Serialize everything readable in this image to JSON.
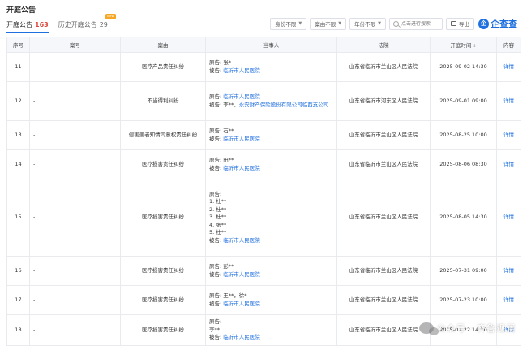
{
  "page": {
    "title": "开庭公告"
  },
  "tabs": [
    {
      "label": "开庭公告",
      "count": "163",
      "active": true
    },
    {
      "label": "历史开庭公告",
      "count": "29",
      "badge": "new"
    }
  ],
  "filters": {
    "identity": "身份不限",
    "cause": "案由不限",
    "year": "年份不限",
    "search_placeholder": "点击进行搜索",
    "export": "导出"
  },
  "brand": {
    "logo": "企",
    "name": "企查查"
  },
  "table": {
    "headers": [
      "序号",
      "案号",
      "案由",
      "当事人",
      "法院",
      "开庭时间",
      "内容"
    ],
    "rows": [
      {
        "no": "11",
        "case": "-",
        "cause": "医疗产品责任纠纷",
        "parties": [
          [
            "原告: ",
            "张*",
            ""
          ],
          [
            "被告: ",
            "",
            "临沂市人民医院"
          ]
        ],
        "court": "山东省临沂市兰山区人民法院",
        "time": "2025-09-02 14:30",
        "detail": "详情"
      },
      {
        "no": "12",
        "case": "-",
        "cause": "不当得利纠纷",
        "parties": [
          [
            "原告: ",
            "",
            "临沂市人民医院"
          ],
          [
            "被告: ",
            "李**，",
            "永安财产保险股份有限公司临西支公司"
          ]
        ],
        "court": "山东省临沂市河东区人民法院",
        "time": "2025-09-01 09:00",
        "detail": "详情"
      },
      {
        "no": "13",
        "case": "-",
        "cause": "侵害患者知情同意权责任纠纷",
        "parties": [
          [
            "原告: ",
            "石**",
            ""
          ],
          [
            "被告: ",
            "",
            "临沂市人民医院"
          ]
        ],
        "court": "山东省临沂市兰山区人民法院",
        "time": "2025-08-25 10:00",
        "detail": "详情"
      },
      {
        "no": "14",
        "case": "-",
        "cause": "医疗损害责任纠纷",
        "parties": [
          [
            "原告: ",
            "田**",
            ""
          ],
          [
            "被告: ",
            "",
            "临沂市人民医院"
          ]
        ],
        "court": "山东省临沂市兰山区人民法院",
        "time": "2025-08-06 08:30",
        "detail": "详情"
      },
      {
        "no": "15",
        "case": "-",
        "cause": "医疗损害责任纠纷",
        "parties": [
          [
            "原告:",
            "",
            ""
          ],
          [
            "",
            "1. 杜**",
            ""
          ],
          [
            "",
            "2. 杜**",
            ""
          ],
          [
            "",
            "3. 杜**",
            ""
          ],
          [
            "",
            "4. 张**",
            ""
          ],
          [
            "",
            "5. 杜**",
            ""
          ],
          [
            "被告: ",
            "",
            "临沂市人民医院"
          ]
        ],
        "court": "山东省临沂市兰山区人民法院",
        "time": "2025-08-05 14:30",
        "detail": "详情"
      },
      {
        "no": "16",
        "case": "-",
        "cause": "医疗损害责任纠纷",
        "parties": [
          [
            "原告: ",
            "彭**",
            ""
          ],
          [
            "被告: ",
            "",
            "临沂市人民医院"
          ]
        ],
        "court": "山东省临沂市兰山区人民法院",
        "time": "2025-07-31 09:00",
        "detail": "详情"
      },
      {
        "no": "17",
        "case": "-",
        "cause": "医疗损害责任纠纷",
        "parties": [
          [
            "原告: ",
            "王**，徐*",
            ""
          ],
          [
            "被告: ",
            "",
            "临沂市人民医院"
          ]
        ],
        "court": "山东省临沂市兰山区人民法院",
        "time": "2025-07-23 10:00",
        "detail": "详情"
      },
      {
        "no": "18",
        "case": "-",
        "cause": "医疗损害责任纠纷",
        "parties": [
          [
            "原告:",
            "",
            ""
          ],
          [
            "",
            "李**",
            ""
          ],
          [
            "被告: ",
            "",
            "临沂市人民医院"
          ]
        ],
        "court": "山东省临沂市兰山区人民法院",
        "time": "2025-07-22 14:30",
        "detail": "详情"
      }
    ]
  },
  "watermark": {
    "text": "公众号 · 齐鲁观澜"
  },
  "colors": {
    "accent": "#1e6fe0",
    "count": "#e0473a",
    "header_bg": "#f5f7fa"
  }
}
